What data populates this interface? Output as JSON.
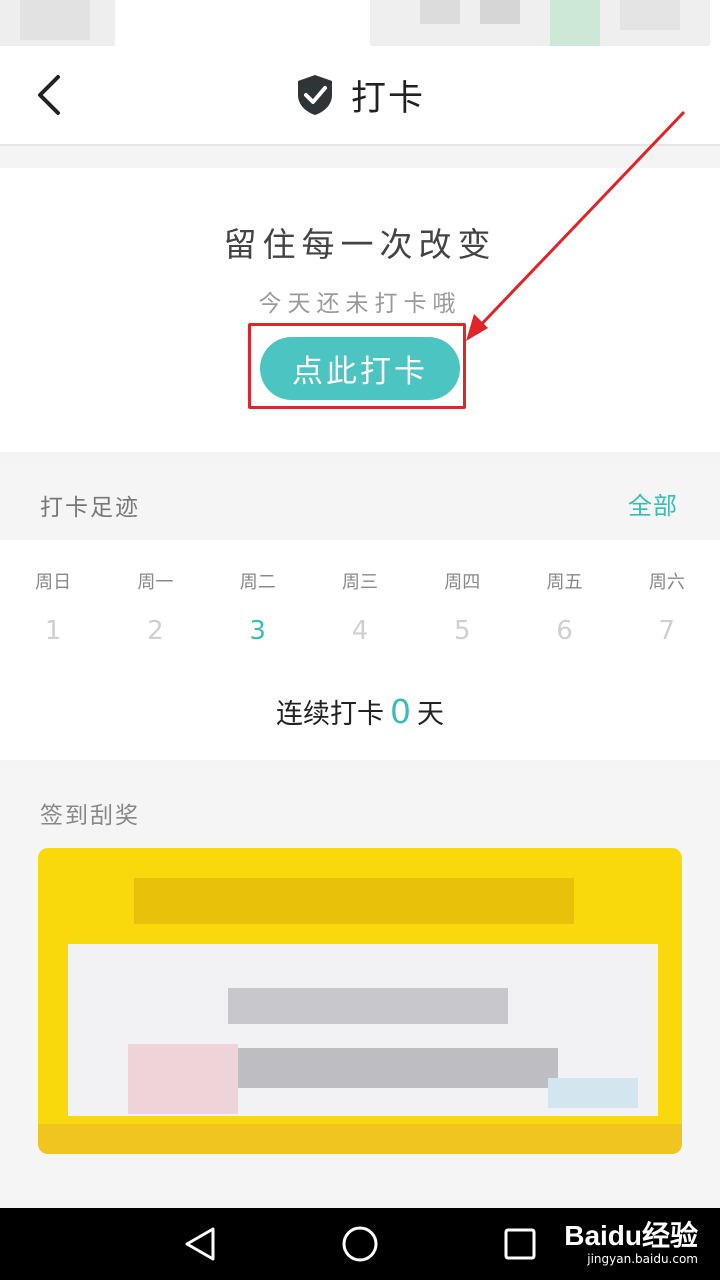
{
  "header": {
    "title": "打卡",
    "back_icon": "chevron-left-icon",
    "title_icon": "shield-check-icon"
  },
  "checkin": {
    "slogan": "留住每一次改变",
    "status": "今天还未打卡哦",
    "button_label": "点此打卡"
  },
  "footprint": {
    "title": "打卡足迹",
    "all_link": "全部",
    "days": [
      {
        "name": "周日",
        "num": "1"
      },
      {
        "name": "周一",
        "num": "2"
      },
      {
        "name": "周二",
        "num": "3"
      },
      {
        "name": "周三",
        "num": "4"
      },
      {
        "name": "周四",
        "num": "5"
      },
      {
        "name": "周五",
        "num": "6"
      },
      {
        "name": "周六",
        "num": "7"
      }
    ],
    "today_index": 2
  },
  "streak": {
    "prefix": "连续打卡",
    "count": "0",
    "suffix": "天"
  },
  "scratch": {
    "title": "签到刮奖"
  },
  "navbar": {
    "back_icon": "triangle-back-icon",
    "home_icon": "circle-home-icon",
    "recents_icon": "square-recents-icon"
  },
  "watermark": {
    "logo": "Baidu经验",
    "url": "jingyan.baidu.com"
  },
  "colors": {
    "accent": "#4cc4c1",
    "highlight": "#e0242a",
    "scratch_yellow": "#f9d90b"
  }
}
